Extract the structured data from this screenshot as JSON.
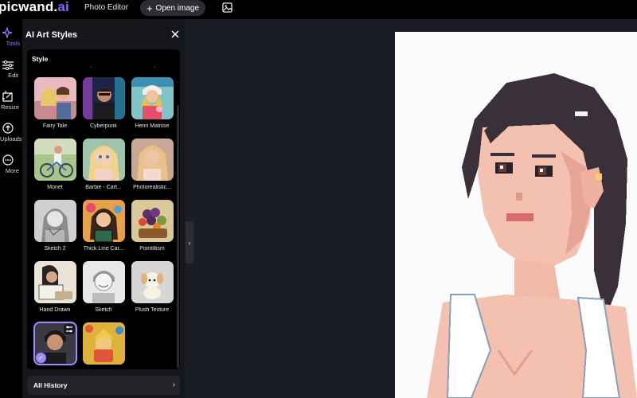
{
  "header": {
    "logo_main": "picwand",
    "logo_dot": ".",
    "logo_ai": "ai",
    "photo_editor": "Photo Editor",
    "open_image": "Open image",
    "open_image_icon": "plus-icon",
    "upload_icon": "image-icon"
  },
  "rail": {
    "items": [
      {
        "label": "Tools",
        "icon": "sparkle-icon"
      },
      {
        "label": "Edit",
        "icon": "sliders-icon"
      },
      {
        "label": "Resize",
        "icon": "resize-icon"
      },
      {
        "label": "Uploads",
        "icon": "upload-icon"
      },
      {
        "label": "More",
        "icon": "more-icon"
      }
    ]
  },
  "panel": {
    "title": "AI Art Styles",
    "section": "Style",
    "styles": [
      {
        "label": "Fairy Tale"
      },
      {
        "label": "Cyberpunk"
      },
      {
        "label": "Henri Matisse"
      },
      {
        "label": "Monet"
      },
      {
        "label": "Barbie - Cart..."
      },
      {
        "label": "Photorealistic..."
      },
      {
        "label": "Sketch 2"
      },
      {
        "label": "Thick Line Car..."
      },
      {
        "label": "Pointillism"
      },
      {
        "label": "Hand Drawn"
      },
      {
        "label": "Sketch"
      },
      {
        "label": "Plush Texture"
      }
    ],
    "history": "All History"
  },
  "colors": {
    "accent": "#7d6cff",
    "selected": "#9b8cff",
    "background": "#1b1d24",
    "panel": "#15171b"
  }
}
